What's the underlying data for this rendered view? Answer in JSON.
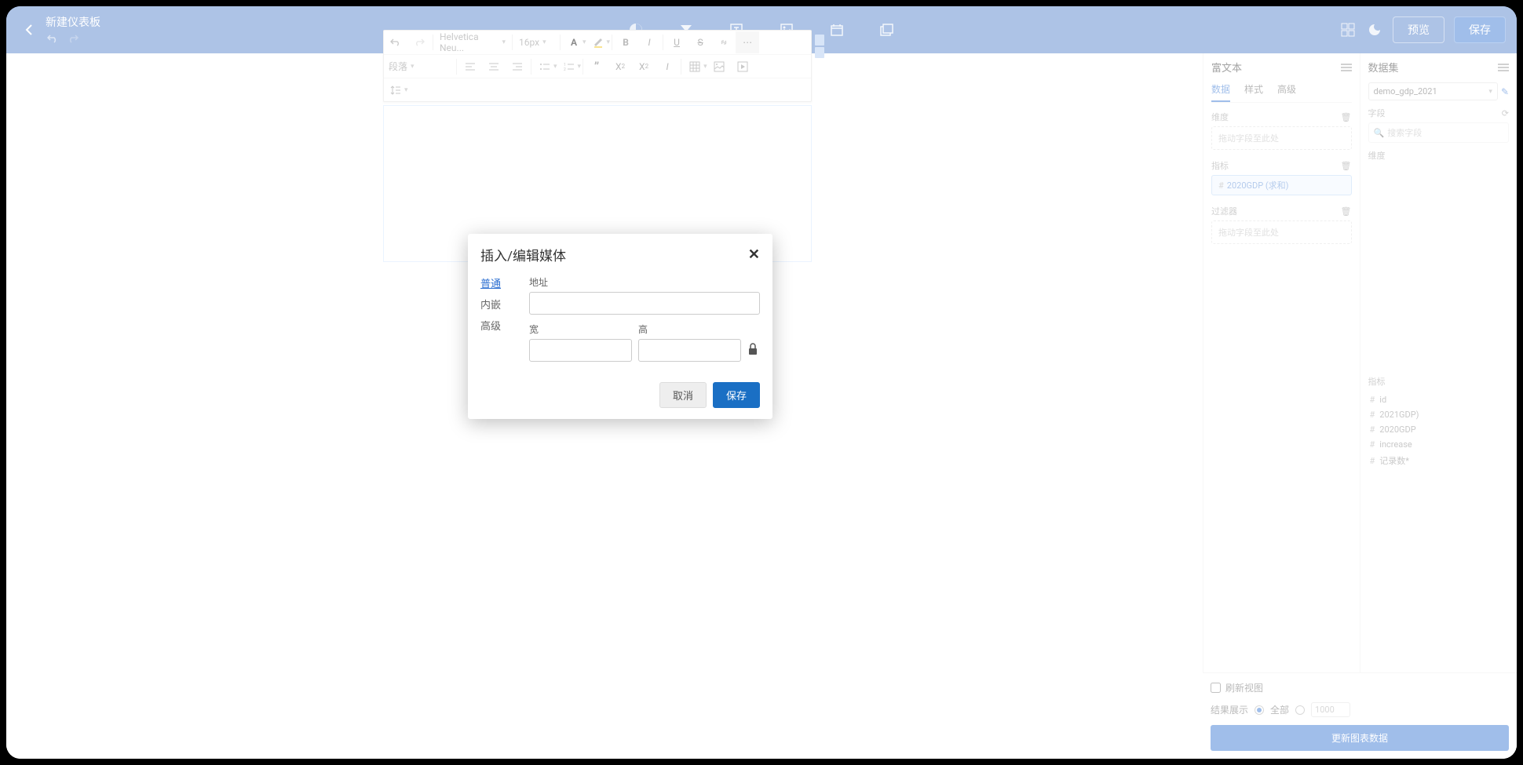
{
  "header": {
    "title": "新建仪表板",
    "preview_label": "预览",
    "save_label": "保存"
  },
  "editor": {
    "font_family": "Helvetica Neu...",
    "font_size": "16px",
    "para_label": "段落"
  },
  "modal": {
    "title": "插入/编辑媒体",
    "tab_general": "普通",
    "tab_embed": "内嵌",
    "tab_advanced": "高级",
    "label_url": "地址",
    "label_width": "宽",
    "label_height": "高",
    "cancel": "取消",
    "save": "保存"
  },
  "panel": {
    "rich_text": "富文本",
    "dataset": "数据集",
    "tab_data": "数据",
    "tab_style": "样式",
    "tab_adv": "高级",
    "dimension": "维度",
    "metric": "指标",
    "filter": "过滤器",
    "drag_hint": "拖动字段至此处",
    "metric_pill": "2020GDP (求和)",
    "ds_selected": "demo_gdp_2021",
    "field_label": "字段",
    "search_placeholder": "搜索字段",
    "metric_group": "指标",
    "fields": [
      "id",
      "2021GDP)",
      "2020GDP",
      "increase",
      "记录数*"
    ],
    "refresh_view": "刷新视图",
    "result_label": "结果展示",
    "result_all": "全部",
    "result_limit": "1000",
    "update_btn": "更新图表数据"
  }
}
